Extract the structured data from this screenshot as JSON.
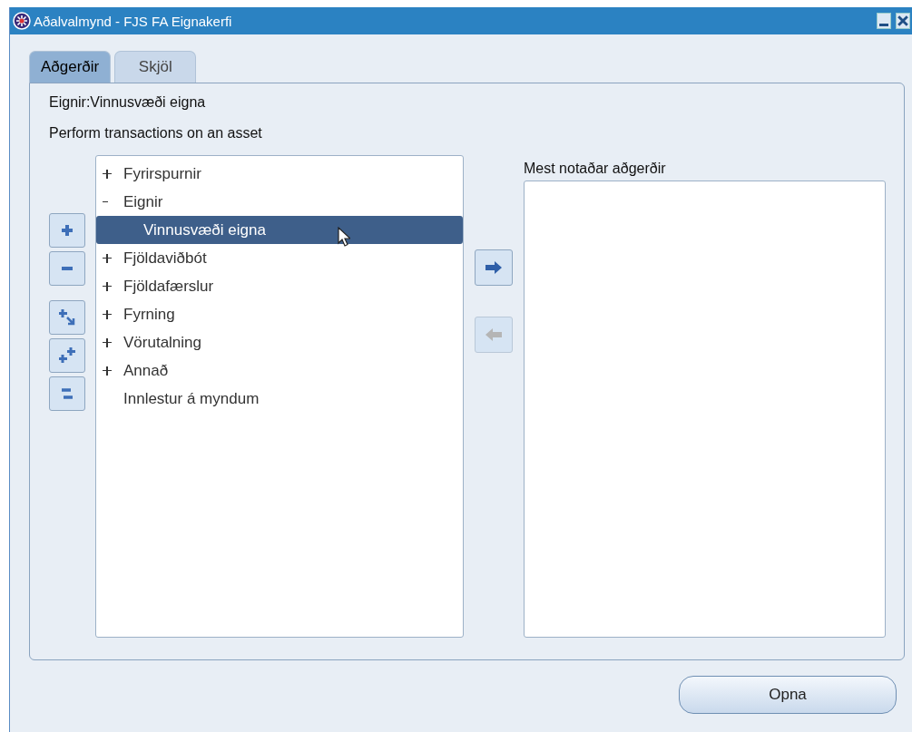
{
  "window": {
    "title": "Aðalvalmynd - FJS FA Eignakerfi"
  },
  "tabs": [
    {
      "label": "Aðgerðir",
      "selected": true
    },
    {
      "label": "Skjöl",
      "selected": false
    }
  ],
  "breadcrumb": "Eignir:Vinnusvæði eigna",
  "instruction": "Perform transactions on an asset",
  "tree": [
    {
      "label": "Fyrirspurnir",
      "expanded": false,
      "selected": false
    },
    {
      "label": "Eignir",
      "expanded": true,
      "selected": false,
      "children": [
        {
          "label": "Vinnusvæði eigna",
          "selected": true
        }
      ]
    },
    {
      "label": "Fjöldaviðbót",
      "expanded": false,
      "selected": false
    },
    {
      "label": "Fjöldafærslur",
      "expanded": false,
      "selected": false
    },
    {
      "label": "Fyrning",
      "expanded": false,
      "selected": false
    },
    {
      "label": "Vörutalning",
      "expanded": false,
      "selected": false
    },
    {
      "label": "Annað",
      "expanded": false,
      "selected": false
    },
    {
      "label": "Innlestur á myndum",
      "selected": false
    }
  ],
  "transfer": {
    "add_disabled": false,
    "remove_disabled": true
  },
  "favorites": {
    "label": "Mest notaðar aðgerðir"
  },
  "buttons": [
    {
      "label": "Opna"
    }
  ]
}
